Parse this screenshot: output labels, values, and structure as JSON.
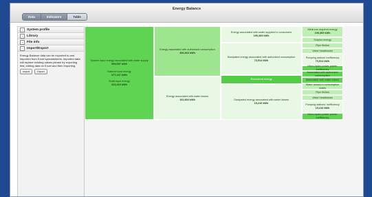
{
  "window": {
    "title": "Energy Balance"
  },
  "tabs": [
    {
      "label": "Data"
    },
    {
      "label": "Indicators"
    },
    {
      "label": "Table"
    }
  ],
  "sidebar": {
    "items": [
      {
        "label": "System profile",
        "icon": "+"
      },
      {
        "label": "Library",
        "icon": "+"
      },
      {
        "label": "File info",
        "icon": "+"
      },
      {
        "label": "Import/Export",
        "icon": "−"
      }
    ],
    "description": "Energy Balance data can be exported to and imported from Excel spreadsheets. Imported data will replace existing values please try exporting first, editing data on Excel and then importing.",
    "buttons": {
      "import": "Import",
      "export": "Export"
    }
  },
  "sankey": {
    "input": {
      "title": "System input energy associated with water supply",
      "value": "599,657 kWh",
      "natural_label": "Natural input energy",
      "natural_value": "377,247 kWh",
      "shaft_label": "Shaft input energy",
      "shaft_value": "222,410 kWh"
    },
    "authorised": {
      "label": "Energy associated with authorised consumption",
      "value": "496,863 kWh"
    },
    "losses": {
      "label": "Energy associated with water losses",
      "value": "102,804 kWh"
    },
    "supplied": {
      "label": "Energy associated with water supplied to consumers",
      "value": "190,369 kWh"
    },
    "dissipated_auth": {
      "label": "Dissipated energy associated with authorized consumption",
      "value": "73,514 kWh"
    },
    "recovered": {
      "label": "Recovered energy"
    },
    "dissipated_loss": {
      "label": "Dissipated energy associated with water losses",
      "value": "15,210 kWh"
    },
    "col4": {
      "min_required": {
        "label": "Minimum required energy",
        "value": "190,369 kWh"
      },
      "surplus": "Surplus energy",
      "pipe_friction": "Pipe friction",
      "valve_headlosses": "Valve headlosses",
      "pumping_auth": {
        "label": "Pumping sations' inefficiency",
        "value": "73,514 kWh"
      },
      "micro_hydro_auth": "Micro-hydro power plants' inefficiency",
      "assoc_auth": "Associated with authorised consumption",
      "assoc_losses": "Associated with water losses",
      "water_losses_nodes": "Water losses in consumption nodes",
      "pipe_friction2": "Pipe friction",
      "valve_headlosses2": "Valve headlosses",
      "pumping_loss": {
        "label": "Pumping stations' inefficiency",
        "value": "15,210 kWh"
      },
      "micro_hydro_loss": "Micro-hydro power plants' inefficiency"
    }
  }
}
